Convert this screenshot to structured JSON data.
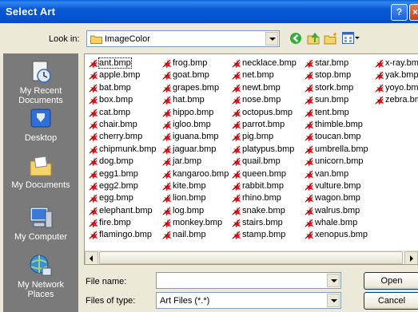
{
  "window": {
    "title": "Select Art",
    "help_label": "?",
    "close_label": "×"
  },
  "toolbar": {
    "look_in_label": "Look in:",
    "look_in_value": "ImageColor"
  },
  "places": [
    {
      "label": "My Recent Documents",
      "icon": "recent-documents-icon"
    },
    {
      "label": "Desktop",
      "icon": "desktop-icon"
    },
    {
      "label": "My Documents",
      "icon": "my-documents-icon"
    },
    {
      "label": "My Computer",
      "icon": "my-computer-icon"
    },
    {
      "label": "My Network Places",
      "icon": "network-places-icon"
    }
  ],
  "files": {
    "columns": [
      [
        "ant.bmp",
        "apple.bmp",
        "bat.bmp",
        "box.bmp",
        "cat.bmp",
        "chair.bmp",
        "cherry.bmp",
        "chipmunk.bmp",
        "dog.bmp",
        "egg1.bmp",
        "egg2.bmp",
        "egg.bmp",
        "elephant.bmp",
        "fire.bmp",
        "flamingo.bmp"
      ],
      [
        "frog.bmp",
        "goat.bmp",
        "grapes.bmp",
        "hat.bmp",
        "hippo.bmp",
        "igloo.bmp",
        "iguana.bmp",
        "jaguar.bmp",
        "jar.bmp",
        "kangaroo.bmp",
        "kite.bmp",
        "lion.bmp",
        "log.bmp",
        "monkey.bmp",
        "nail.bmp"
      ],
      [
        "necklace.bmp",
        "net.bmp",
        "newt.bmp",
        "nose.bmp",
        "octopus.bmp",
        "parrot.bmp",
        "pig.bmp",
        "platypus.bmp",
        "quail.bmp",
        "queen.bmp",
        "rabbit.bmp",
        "rhino.bmp",
        "snake.bmp",
        "stairs.bmp",
        "stamp.bmp"
      ],
      [
        "star.bmp",
        "stop.bmp",
        "stork.bmp",
        "sun.bmp",
        "tent.bmp",
        "thimble.bmp",
        "toucan.bmp",
        "umbrella.bmp",
        "unicorn.bmp",
        "van.bmp",
        "vulture.bmp",
        "wagon.bmp",
        "walrus.bmp",
        "whale.bmp",
        "xenopus.bmp"
      ],
      [
        "x-ray.bmp",
        "yak.bmp",
        "yoyo.bmp",
        "zebra.bmp"
      ]
    ],
    "selected": "ant.bmp",
    "file_icon": "paint-bitmap-icon",
    "icon_color": "#e8101a"
  },
  "bottom": {
    "file_name_label": "File name:",
    "file_name_value": "",
    "file_type_label": "Files of type:",
    "file_type_value": "Art Files (*.*)",
    "open_label": "Open",
    "cancel_label": "Cancel"
  }
}
